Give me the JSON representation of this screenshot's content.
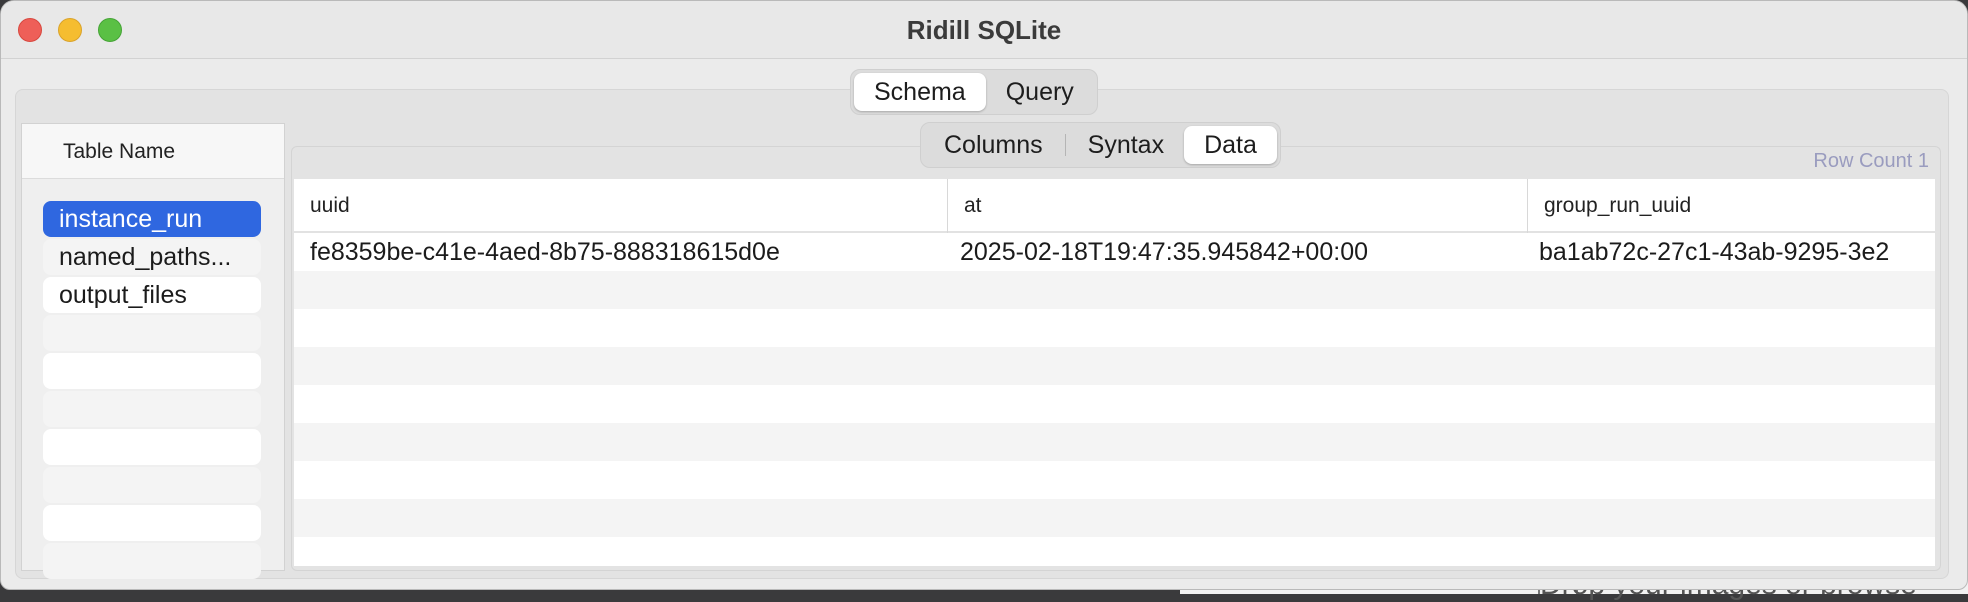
{
  "window": {
    "title": "Ridill SQLite"
  },
  "main_tabs": [
    {
      "label": "Schema",
      "active": true
    },
    {
      "label": "Query",
      "active": false
    }
  ],
  "sub_tabs": [
    {
      "label": "Columns",
      "active": false
    },
    {
      "label": "Syntax",
      "active": false
    },
    {
      "label": "Data",
      "active": true
    }
  ],
  "sidebar": {
    "header": "Table Name",
    "items": [
      {
        "label": "instance_run",
        "selected": true
      },
      {
        "label": "named_paths...",
        "selected": false
      },
      {
        "label": "output_files",
        "selected": false
      }
    ]
  },
  "data_view": {
    "row_count_label": "Row Count 1",
    "columns": [
      "uuid",
      "at",
      "group_run_uuid"
    ],
    "rows": [
      [
        "fe8359be-c41e-4aed-8b75-888318615d0e",
        "2025-02-18T19:47:35.945842+00:00",
        "ba1ab72c-27c1-43ab-9295-3e2"
      ]
    ]
  },
  "background_app": {
    "text": "Drop your images or browse"
  },
  "colors": {
    "selection": "#2f67e0",
    "row_count": "#9a9cbf",
    "close": "#ee5f58",
    "minimize": "#f5bd30",
    "maximize": "#5ac044"
  }
}
